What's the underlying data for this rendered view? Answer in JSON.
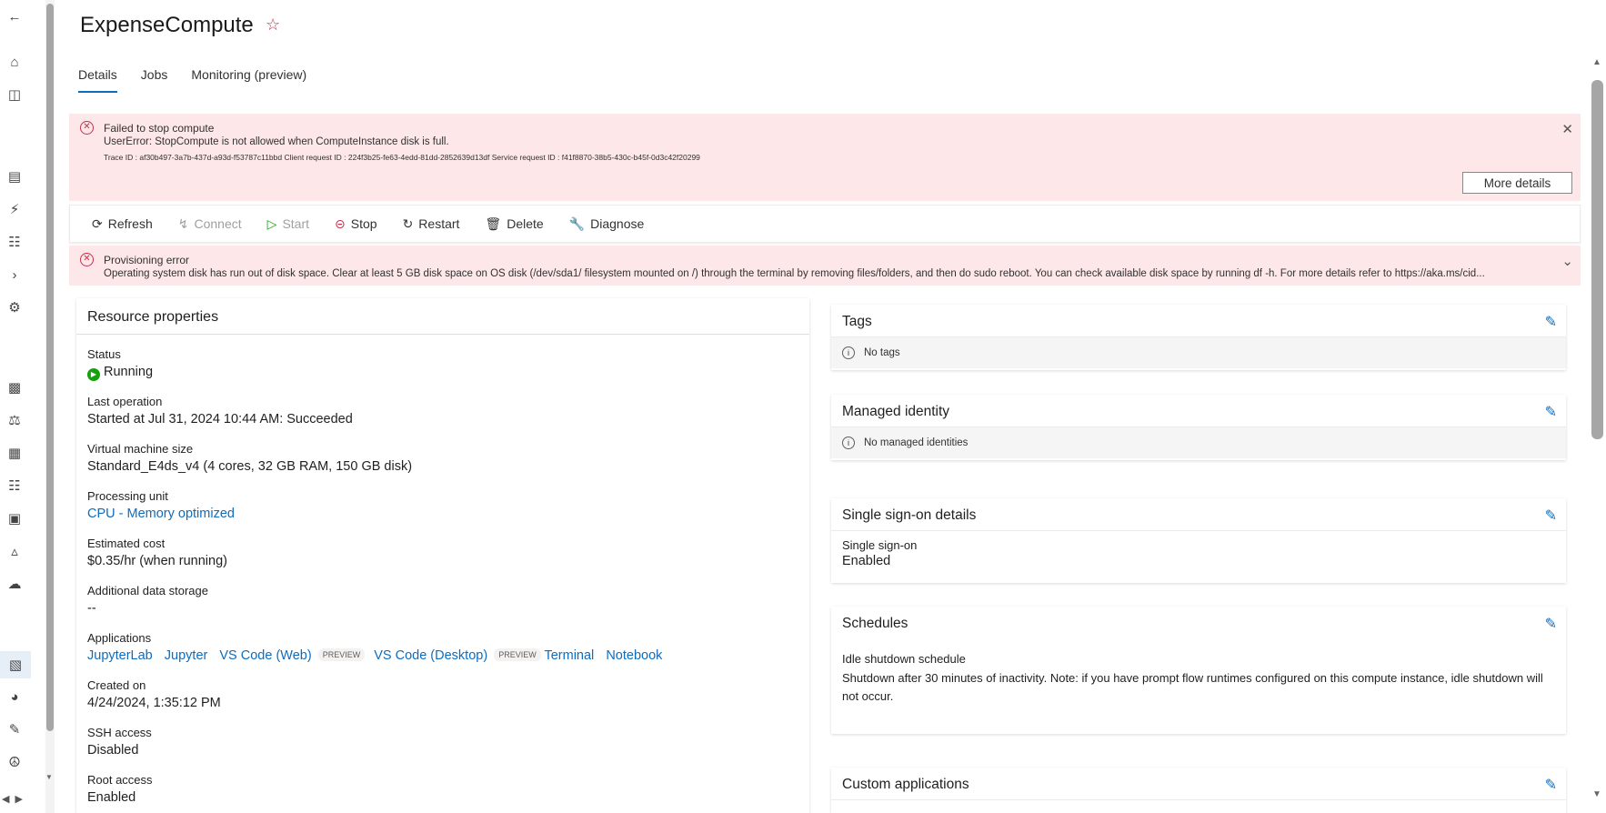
{
  "nav_icons": [
    "back-arrow-icon",
    "home-icon",
    "model-catalog-icon",
    "notebooks-icon",
    "automl-icon",
    "designer-icon",
    "prompt-flow-icon",
    "data-icon",
    "jobs-icon",
    "components-icon",
    "pipelines-icon",
    "environments-icon",
    "models-icon",
    "endpoints-icon",
    "compute-icon",
    "monitoring-icon",
    "data-labeling-icon",
    "linked-services-icon"
  ],
  "header": {
    "title": "ExpenseCompute",
    "favorite_icon": "star-icon"
  },
  "tabs": [
    {
      "label": "Details",
      "active": true
    },
    {
      "label": "Jobs",
      "active": false
    },
    {
      "label": "Monitoring (preview)",
      "active": false
    }
  ],
  "error_banner": {
    "title": "Failed to stop compute",
    "message": "UserError: StopCompute is not allowed when ComputeInstance disk is full.",
    "trace": "Trace ID : af30b497-3a7b-437d-a93d-f53787c11bbd  Client request ID : 224f3b25-fe63-4edd-81dd-2852639d13df  Service request ID : f41f8870-38b5-430c-b45f-0d3c42f20299",
    "more_details": "More details"
  },
  "toolbar": {
    "refresh": "Refresh",
    "connect": "Connect",
    "start": "Start",
    "stop": "Stop",
    "restart": "Restart",
    "delete": "Delete",
    "diagnose": "Diagnose"
  },
  "provisioning_banner": {
    "title": "Provisioning error",
    "message": "Operating system disk has run out of disk space. Clear at least 5 GB disk space on OS disk (/dev/sda1/ filesystem mounted on /) through the terminal by removing files/folders, and then do sudo reboot. You can check available disk space by running df -h. For more details refer to https://aka.ms/cid..."
  },
  "resource_properties": {
    "title": "Resource properties",
    "status_label": "Status",
    "status_value": "Running",
    "last_operation_label": "Last operation",
    "last_operation_value": "Started at Jul 31, 2024 10:44 AM: Succeeded",
    "vm_size_label": "Virtual machine size",
    "vm_size_value": "Standard_E4ds_v4 (4 cores, 32 GB RAM, 150 GB disk)",
    "processing_unit_label": "Processing unit",
    "processing_unit_value": "CPU - Memory optimized",
    "estimated_cost_label": "Estimated cost",
    "estimated_cost_value": "$0.35/hr (when running)",
    "additional_storage_label": "Additional data storage",
    "additional_storage_value": "--",
    "applications_label": "Applications",
    "applications": {
      "jupyterlab": "JupyterLab",
      "jupyter": "Jupyter",
      "vscode_web": "VS Code (Web)",
      "preview1": "PREVIEW",
      "vscode_desktop": "VS Code (Desktop)",
      "preview2": "PREVIEW",
      "terminal": "Terminal",
      "notebook": "Notebook"
    },
    "created_on_label": "Created on",
    "created_on_value": "4/24/2024, 1:35:12 PM",
    "ssh_label": "SSH access",
    "ssh_value": "Disabled",
    "root_label": "Root access",
    "root_value": "Enabled"
  },
  "tags": {
    "title": "Tags",
    "empty": "No tags"
  },
  "managed_identity": {
    "title": "Managed identity",
    "empty": "No managed identities"
  },
  "sso": {
    "title": "Single sign-on details",
    "label": "Single sign-on",
    "value": "Enabled"
  },
  "schedules": {
    "title": "Schedules",
    "label": "Idle shutdown schedule",
    "value": "Shutdown after 30 minutes of inactivity. Note: if you have prompt flow runtimes configured on this compute instance, idle shutdown will not occur."
  },
  "custom_apps": {
    "title": "Custom applications"
  }
}
